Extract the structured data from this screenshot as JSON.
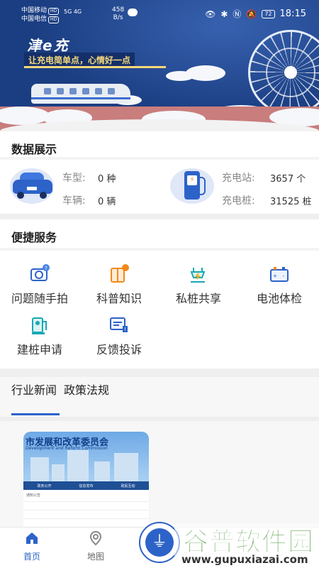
{
  "status_bar": {
    "carrier1": "中国移动",
    "carrier2": "中国电信",
    "hd": "HD",
    "network": "5G 4G",
    "speed_value": "458",
    "speed_unit": "B/s",
    "battery": "72",
    "time": "18:15"
  },
  "banner": {
    "app_name": "津e充",
    "slogan": "让充电简单点，心情好一点"
  },
  "data_display": {
    "title": "数据展示",
    "vehicle_type_label": "车型:",
    "vehicle_type_value": "0 种",
    "vehicle_count_label": "车辆:",
    "vehicle_count_value": "0 辆",
    "station_label": "充电站:",
    "station_value": "3657 个",
    "pile_label": "充电桩:",
    "pile_value": "31525 桩"
  },
  "services": {
    "title": "便捷服务",
    "items": [
      {
        "label": "问题随手拍",
        "icon": "camera-icon"
      },
      {
        "label": "科普知识",
        "icon": "book-icon"
      },
      {
        "label": "私桩共享",
        "icon": "plug-share-icon"
      },
      {
        "label": "电池体检",
        "icon": "battery-icon"
      },
      {
        "label": "建桩申请",
        "icon": "charger-apply-icon"
      },
      {
        "label": "反馈投诉",
        "icon": "feedback-icon"
      }
    ]
  },
  "news": {
    "tabs": [
      "行业新闻",
      "政策法规"
    ],
    "card_title": "市发展和改革委员会",
    "card_subtitle": "Development and Reform Commission",
    "card_nav": [
      "政务公开",
      "信息发布",
      "政民互动"
    ],
    "card_line": "通知公告"
  },
  "bottom_nav": {
    "home": "首页",
    "map": "地图"
  },
  "watermark": {
    "text": "谷普软件园",
    "url": "www.gupuxiazai.com"
  },
  "colors": {
    "accent": "#2d63c8",
    "banner_bg": "#1b3e82",
    "slogan": "#f3d77a"
  }
}
